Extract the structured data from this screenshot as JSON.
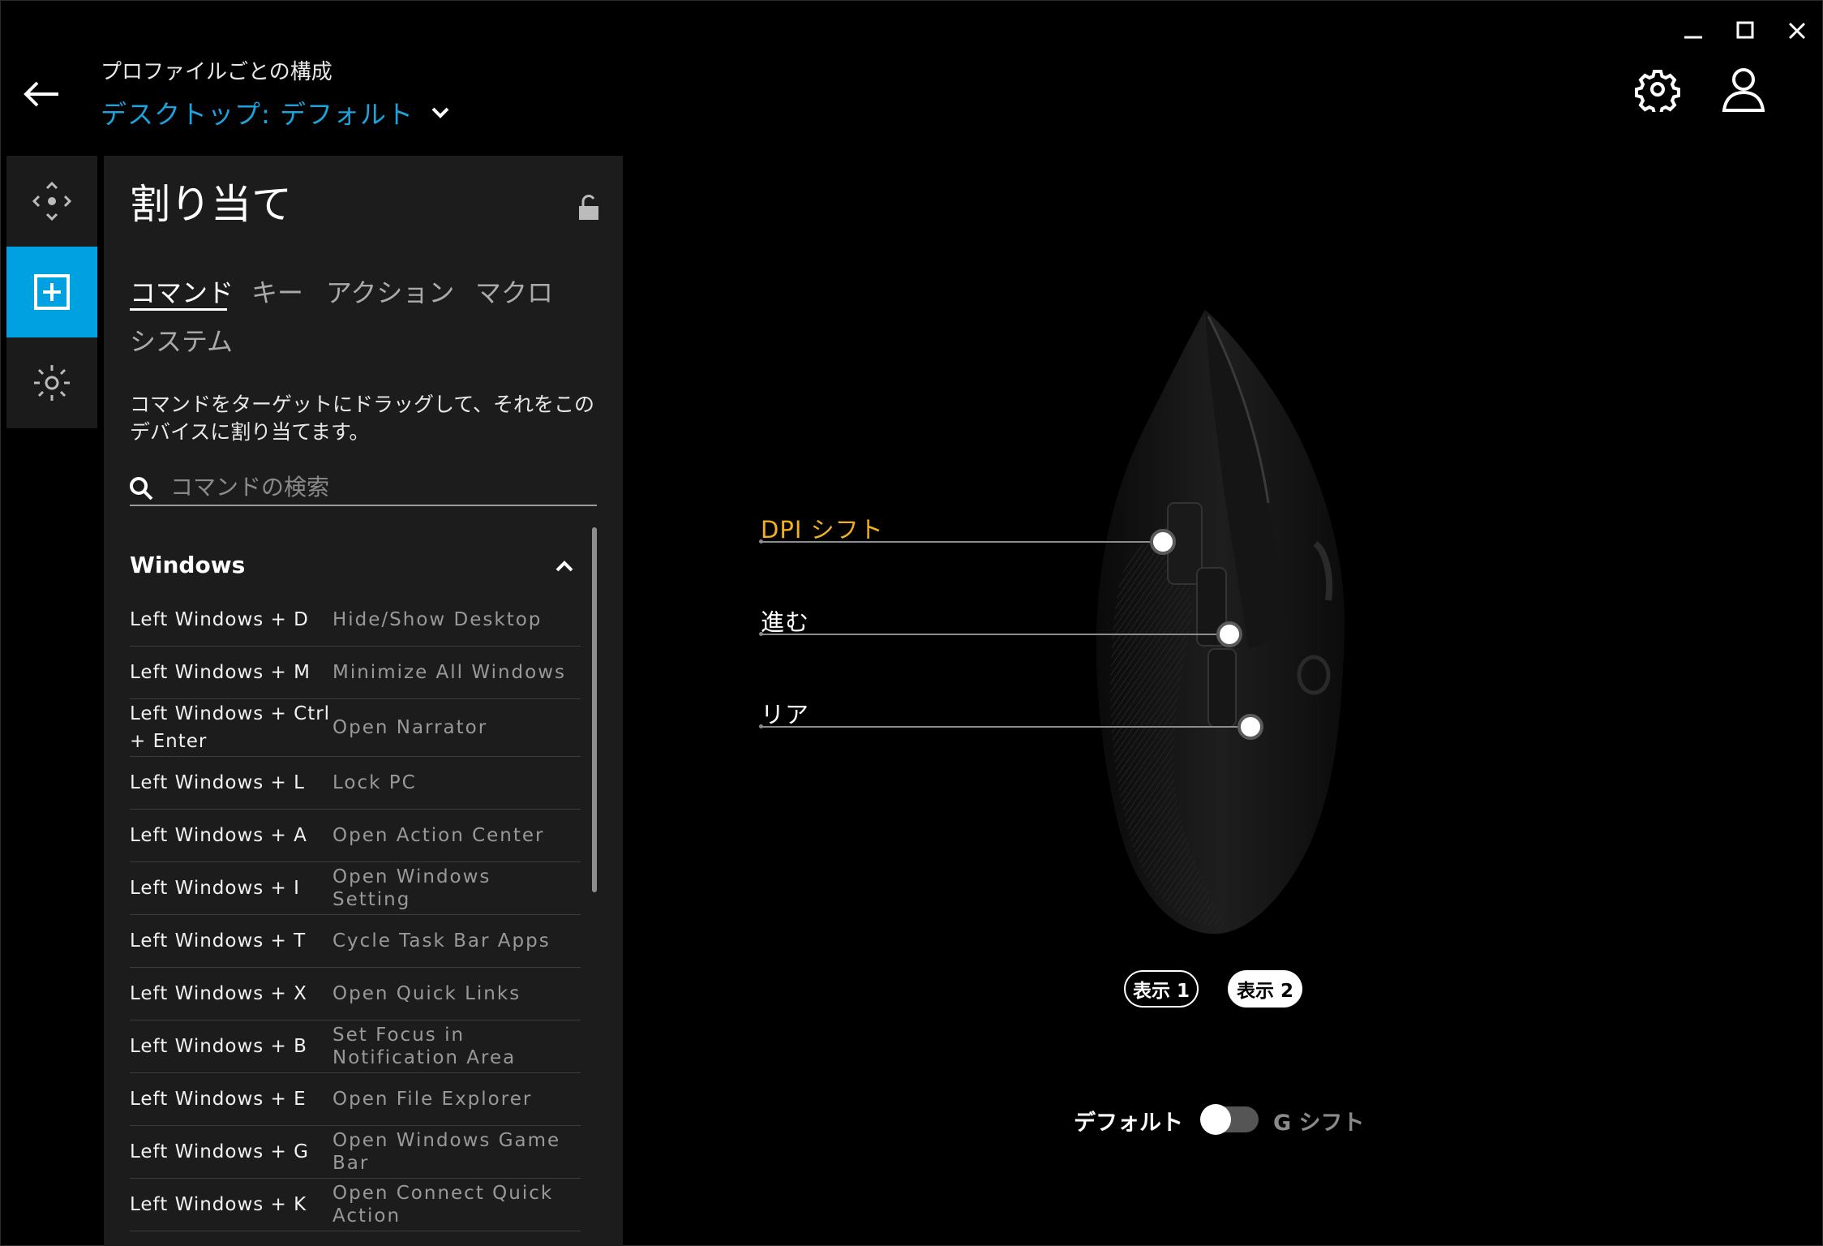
{
  "header": {
    "caption": "プロファイルごとの構成",
    "profile_name": "デスクトップ: デフォルト"
  },
  "rail": {
    "items": [
      {
        "icon": "move-icon",
        "active": false
      },
      {
        "icon": "add-square-icon",
        "active": true
      },
      {
        "icon": "lighting-icon",
        "active": false
      }
    ]
  },
  "panel": {
    "title": "割り当て",
    "tabs": [
      "コマンド",
      "キー",
      "アクション",
      "マクロ",
      "システム"
    ],
    "active_tab": "コマンド",
    "instructions": "コマンドをターゲットにドラッグして、それをこのデバイスに割り当てます。",
    "search_placeholder": "コマンドの検索",
    "group_title": "Windows",
    "commands": [
      {
        "key": "Left Windows + D",
        "action": "Hide/Show Desktop"
      },
      {
        "key": "Left Windows + M",
        "action": "Minimize All Windows"
      },
      {
        "key": "Left Windows + Ctrl + Enter",
        "action": "Open Narrator"
      },
      {
        "key": "Left Windows + L",
        "action": "Lock PC"
      },
      {
        "key": "Left Windows + A",
        "action": "Open Action Center"
      },
      {
        "key": "Left Windows + I",
        "action": "Open Windows Setting"
      },
      {
        "key": "Left Windows + T",
        "action": "Cycle Task Bar Apps"
      },
      {
        "key": "Left Windows + X",
        "action": "Open Quick Links"
      },
      {
        "key": "Left Windows + B",
        "action": "Set Focus in Notification Area"
      },
      {
        "key": "Left Windows + E",
        "action": "Open File Explorer"
      },
      {
        "key": "Left Windows + G",
        "action": "Open Windows Game Bar"
      },
      {
        "key": "Left Windows + K",
        "action": "Open Connect Quick Action"
      }
    ]
  },
  "device": {
    "callouts": {
      "dpi": "DPI シフト",
      "forward": "進む",
      "back": "リア"
    },
    "views": [
      "表示 1",
      "表示 2"
    ],
    "selected_view": "表示 2",
    "mode_default": "デフォルト",
    "mode_gshift": "G シフト",
    "gshift_enabled": false
  },
  "colors": {
    "accent": "#00a1e0",
    "profile_link": "#1aa3dd",
    "dpi_label": "#f0b020",
    "panel_bg": "#1c1c1c"
  }
}
